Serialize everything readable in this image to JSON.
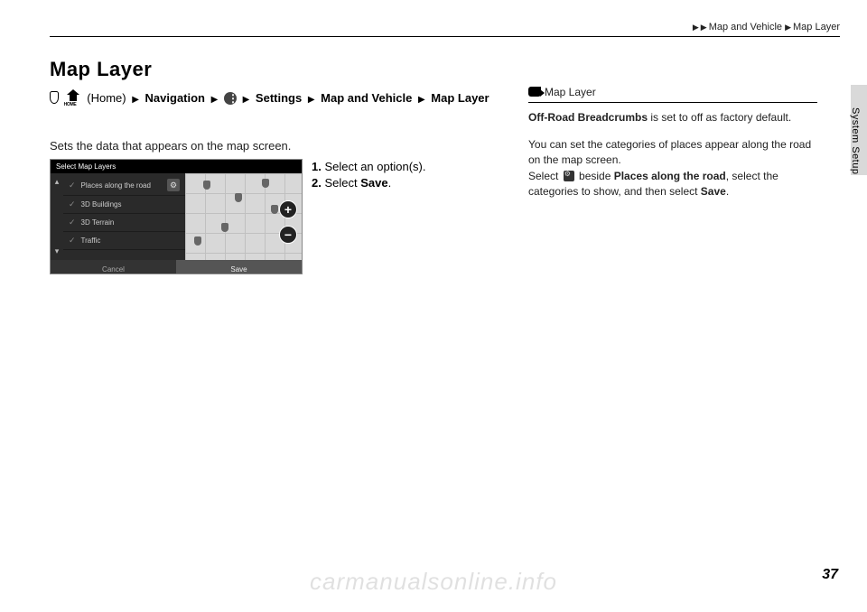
{
  "breadcrumb": {
    "a": "Map and Vehicle",
    "b": "Map Layer"
  },
  "title": "Map Layer",
  "path": {
    "home": "(Home)",
    "nav": "Navigation",
    "settings": "Settings",
    "mv": "Map and Vehicle",
    "ml": "Map Layer"
  },
  "desc": "Sets the data that appears on the map screen.",
  "shot": {
    "header": "Select Map Layers",
    "rows": [
      "Places along the road",
      "3D Buildings",
      "3D Terrain",
      "Traffic"
    ],
    "cancel": "Cancel",
    "save": "Save"
  },
  "steps": {
    "s1n": "1.",
    "s1": " Select an option(s).",
    "s2n": "2.",
    "s2": " Select ",
    "s2b": "Save",
    "s2c": "."
  },
  "side": {
    "title": "Map Layer",
    "p1a": "Off-Road Breadcrumbs",
    "p1b": " is set to off as factory default.",
    "p2": "You can set the categories of places appear along the road on the map screen.",
    "p3a": "Select ",
    "p3b": " beside ",
    "p3c": "Places along the road",
    "p3d": ", select the categories to show, and then select ",
    "p3e": "Save",
    "p3f": "."
  },
  "sidetab": "System Setup",
  "pagenum": "37",
  "watermark": "carmanualsonline.info"
}
